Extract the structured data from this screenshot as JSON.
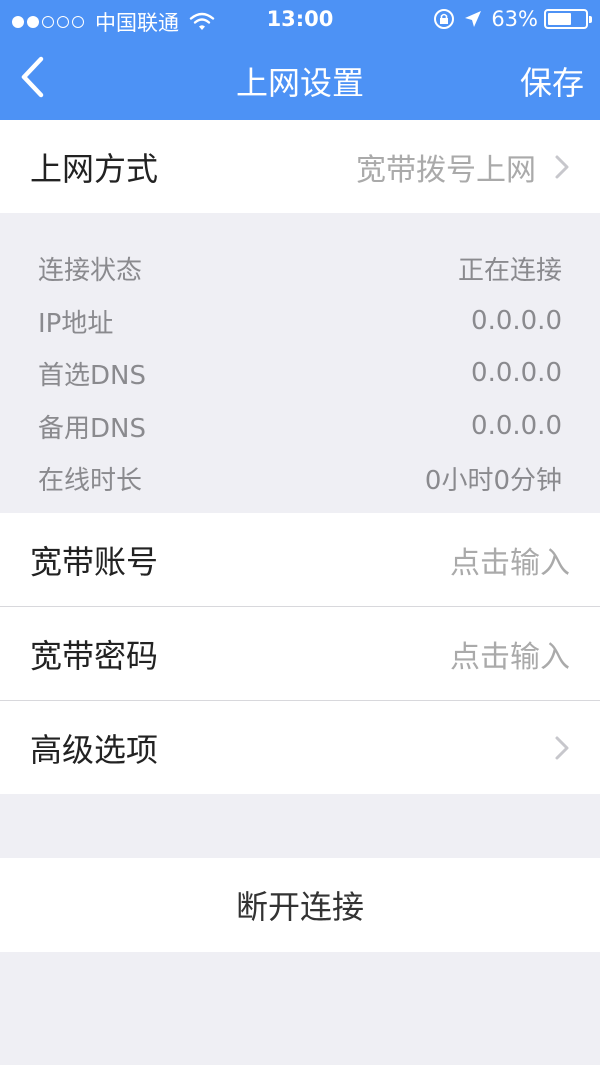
{
  "status_bar": {
    "carrier": "中国联通",
    "time": "13:00",
    "battery": "63%",
    "battery_level": 0.63,
    "signal_dots_filled": 2,
    "signal_dots_total": 5
  },
  "nav": {
    "title": "上网设置",
    "save_label": "保存",
    "back_icon": "chevron-left-icon"
  },
  "connection_mode": {
    "label": "上网方式",
    "value": "宽带拨号上网"
  },
  "info": [
    {
      "label": "连接状态",
      "value": "正在连接"
    },
    {
      "label": "IP地址",
      "value": "0.0.0.0"
    },
    {
      "label": "首选DNS",
      "value": "0.0.0.0"
    },
    {
      "label": "备用DNS",
      "value": "0.0.0.0"
    },
    {
      "label": "在线时长",
      "value": "0小时0分钟"
    }
  ],
  "account": {
    "label": "宽带账号",
    "placeholder": "点击输入"
  },
  "password": {
    "label": "宽带密码",
    "placeholder": "点击输入"
  },
  "advanced": {
    "label": "高级选项"
  },
  "disconnect_label": "断开连接",
  "colors": {
    "accent": "#4d92f5",
    "background": "#efeff4"
  }
}
